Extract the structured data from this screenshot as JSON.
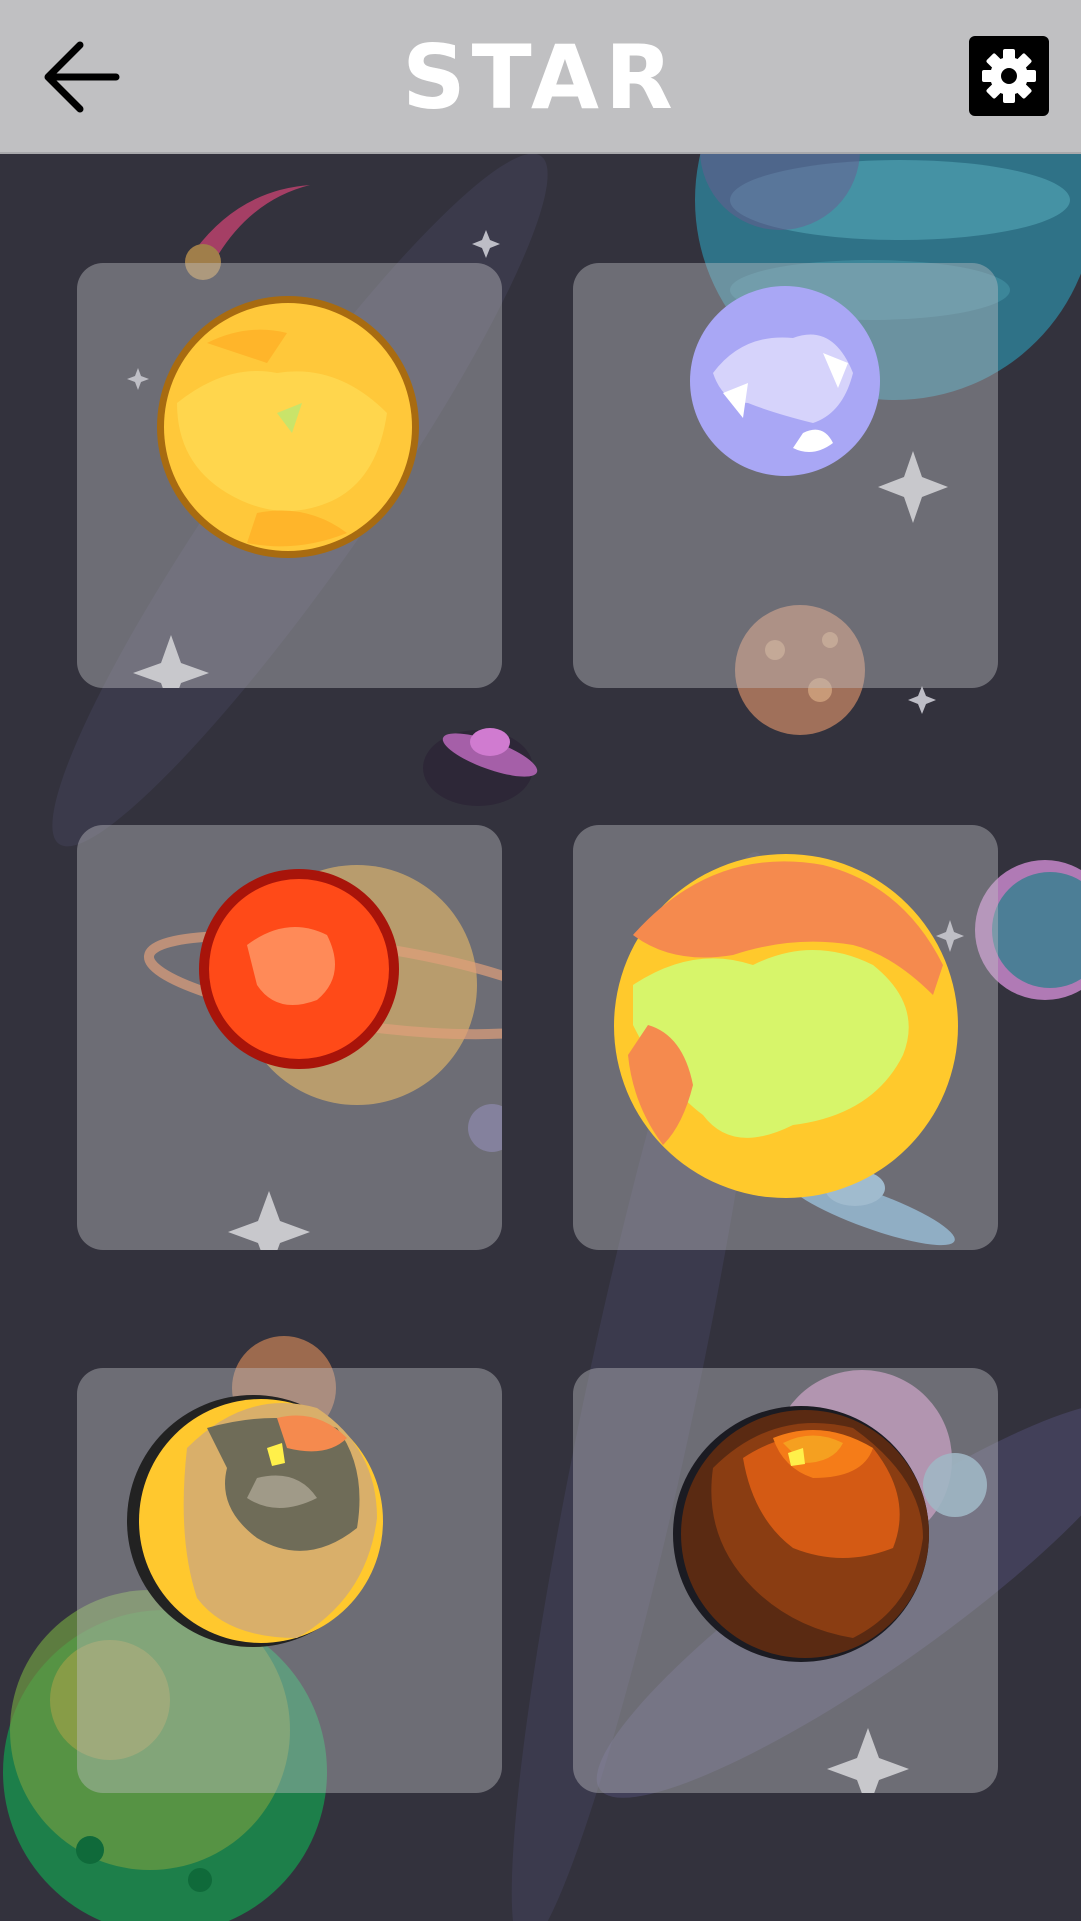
{
  "header": {
    "title": "STAR",
    "back_icon": "arrow-left-icon",
    "settings_icon": "gear-icon"
  },
  "levels": [
    {
      "id": "sun",
      "icon": "sun-planet-icon"
    },
    {
      "id": "lavender",
      "icon": "lavender-planet-icon"
    },
    {
      "id": "red-star",
      "icon": "red-star-icon"
    },
    {
      "id": "yellow-green",
      "icon": "yellow-green-planet-icon"
    },
    {
      "id": "khaki",
      "icon": "khaki-planet-icon"
    },
    {
      "id": "orange-brown",
      "icon": "orange-brown-planet-icon"
    }
  ],
  "colors": {
    "background": "#33323d",
    "header": "#c0c0c2",
    "tile": "rgba(190,190,196,0.42)"
  }
}
